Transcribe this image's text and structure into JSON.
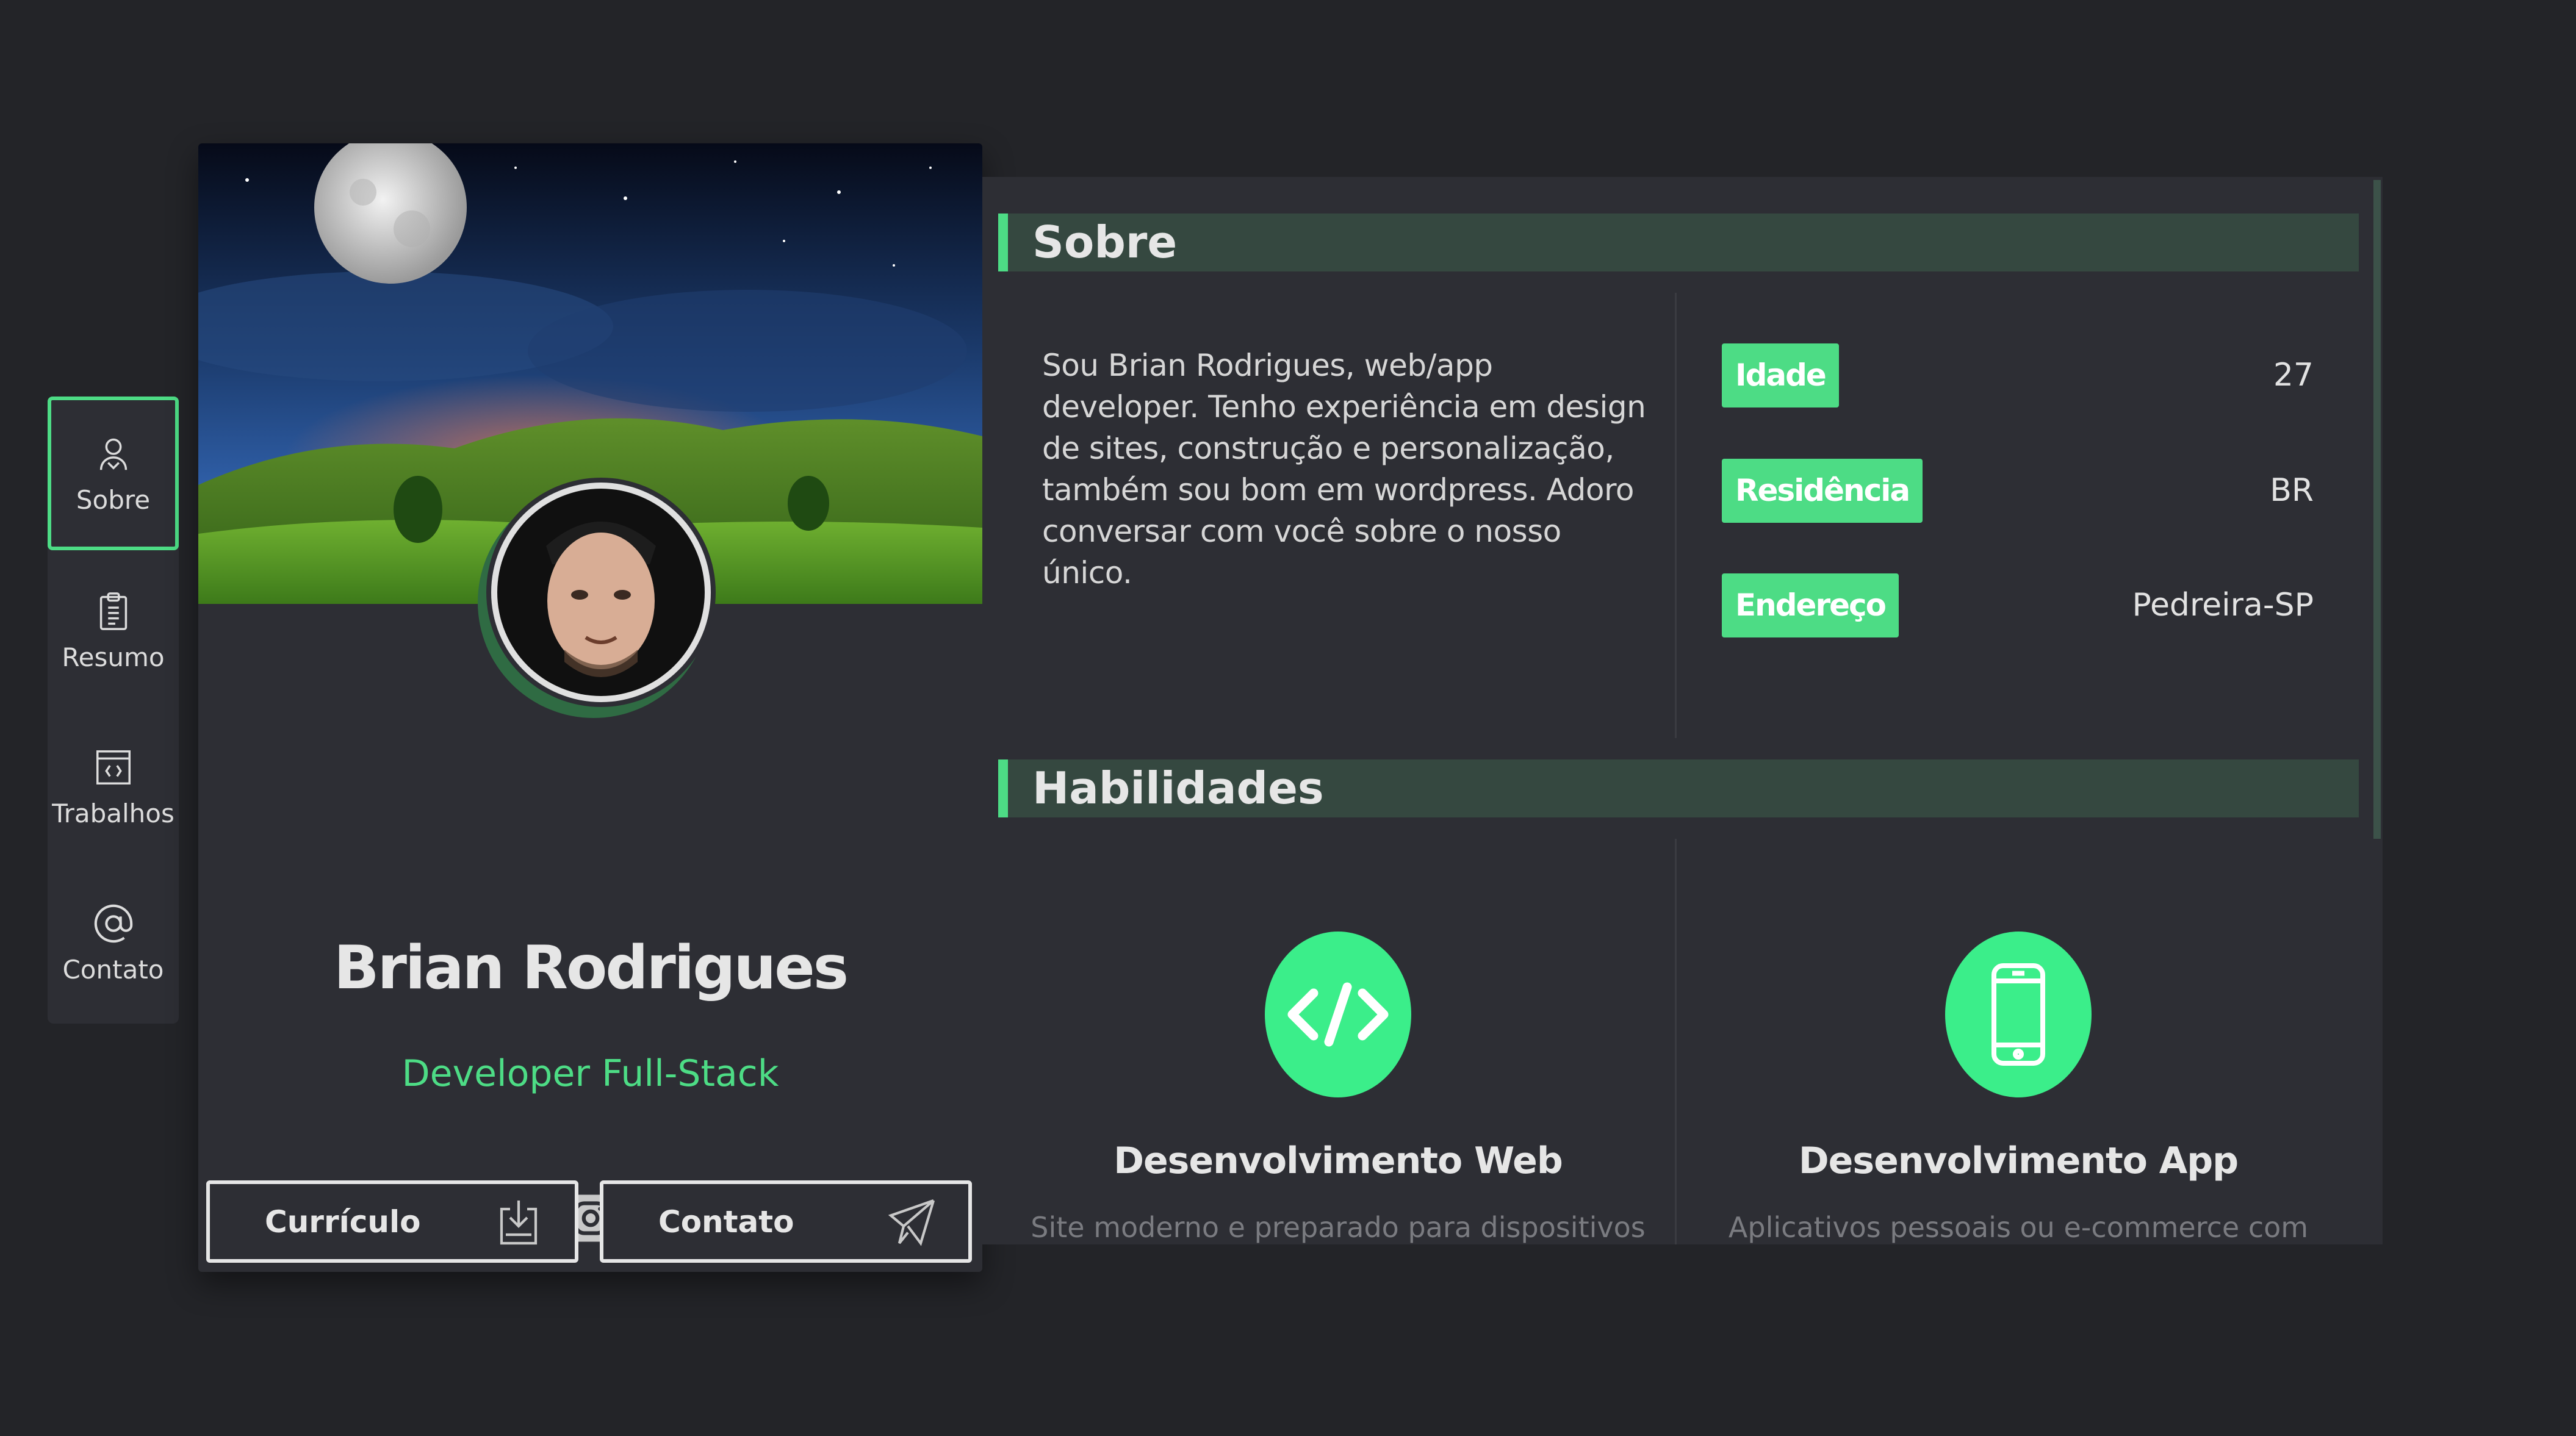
{
  "nav": {
    "items": [
      {
        "label": "Sobre",
        "icon": "person-icon",
        "active": true
      },
      {
        "label": "Resumo",
        "icon": "clipboard-icon",
        "active": false
      },
      {
        "label": "Trabalhos",
        "icon": "code-window-icon",
        "active": false
      },
      {
        "label": "Contato",
        "icon": "at-icon",
        "active": false
      }
    ]
  },
  "profile": {
    "name": "Brian Rodrigues",
    "role": "Developer Full-Stack",
    "socials": [
      "twitter-icon",
      "instagram-icon",
      "github-icon"
    ],
    "buttons": {
      "resume": "Currículo",
      "contact": "Contato"
    }
  },
  "about": {
    "heading": "Sobre",
    "text": "Sou Brian Rodrigues, web/app developer. Tenho experiência em design de sites, construção e personalização, também sou bom em wordpress. Adoro conversar com você sobre o nosso único.",
    "info": [
      {
        "label": "Idade",
        "value": "27"
      },
      {
        "label": "Residência",
        "value": "BR"
      },
      {
        "label": "Endereço",
        "value": "Pedreira-SP"
      }
    ]
  },
  "skills": {
    "heading": "Habilidades",
    "items": [
      {
        "title": "Desenvolvimento Web",
        "desc": "Site moderno e preparado para dispositivos",
        "icon": "code-icon"
      },
      {
        "title": "Desenvolvimento App",
        "desc": "Aplicativos pessoais ou e-commerce com",
        "icon": "smartphone-icon"
      }
    ]
  },
  "colors": {
    "accent": "#4ddc85",
    "background": "#232428",
    "card": "#2d2e34",
    "section_head": "#354840"
  }
}
